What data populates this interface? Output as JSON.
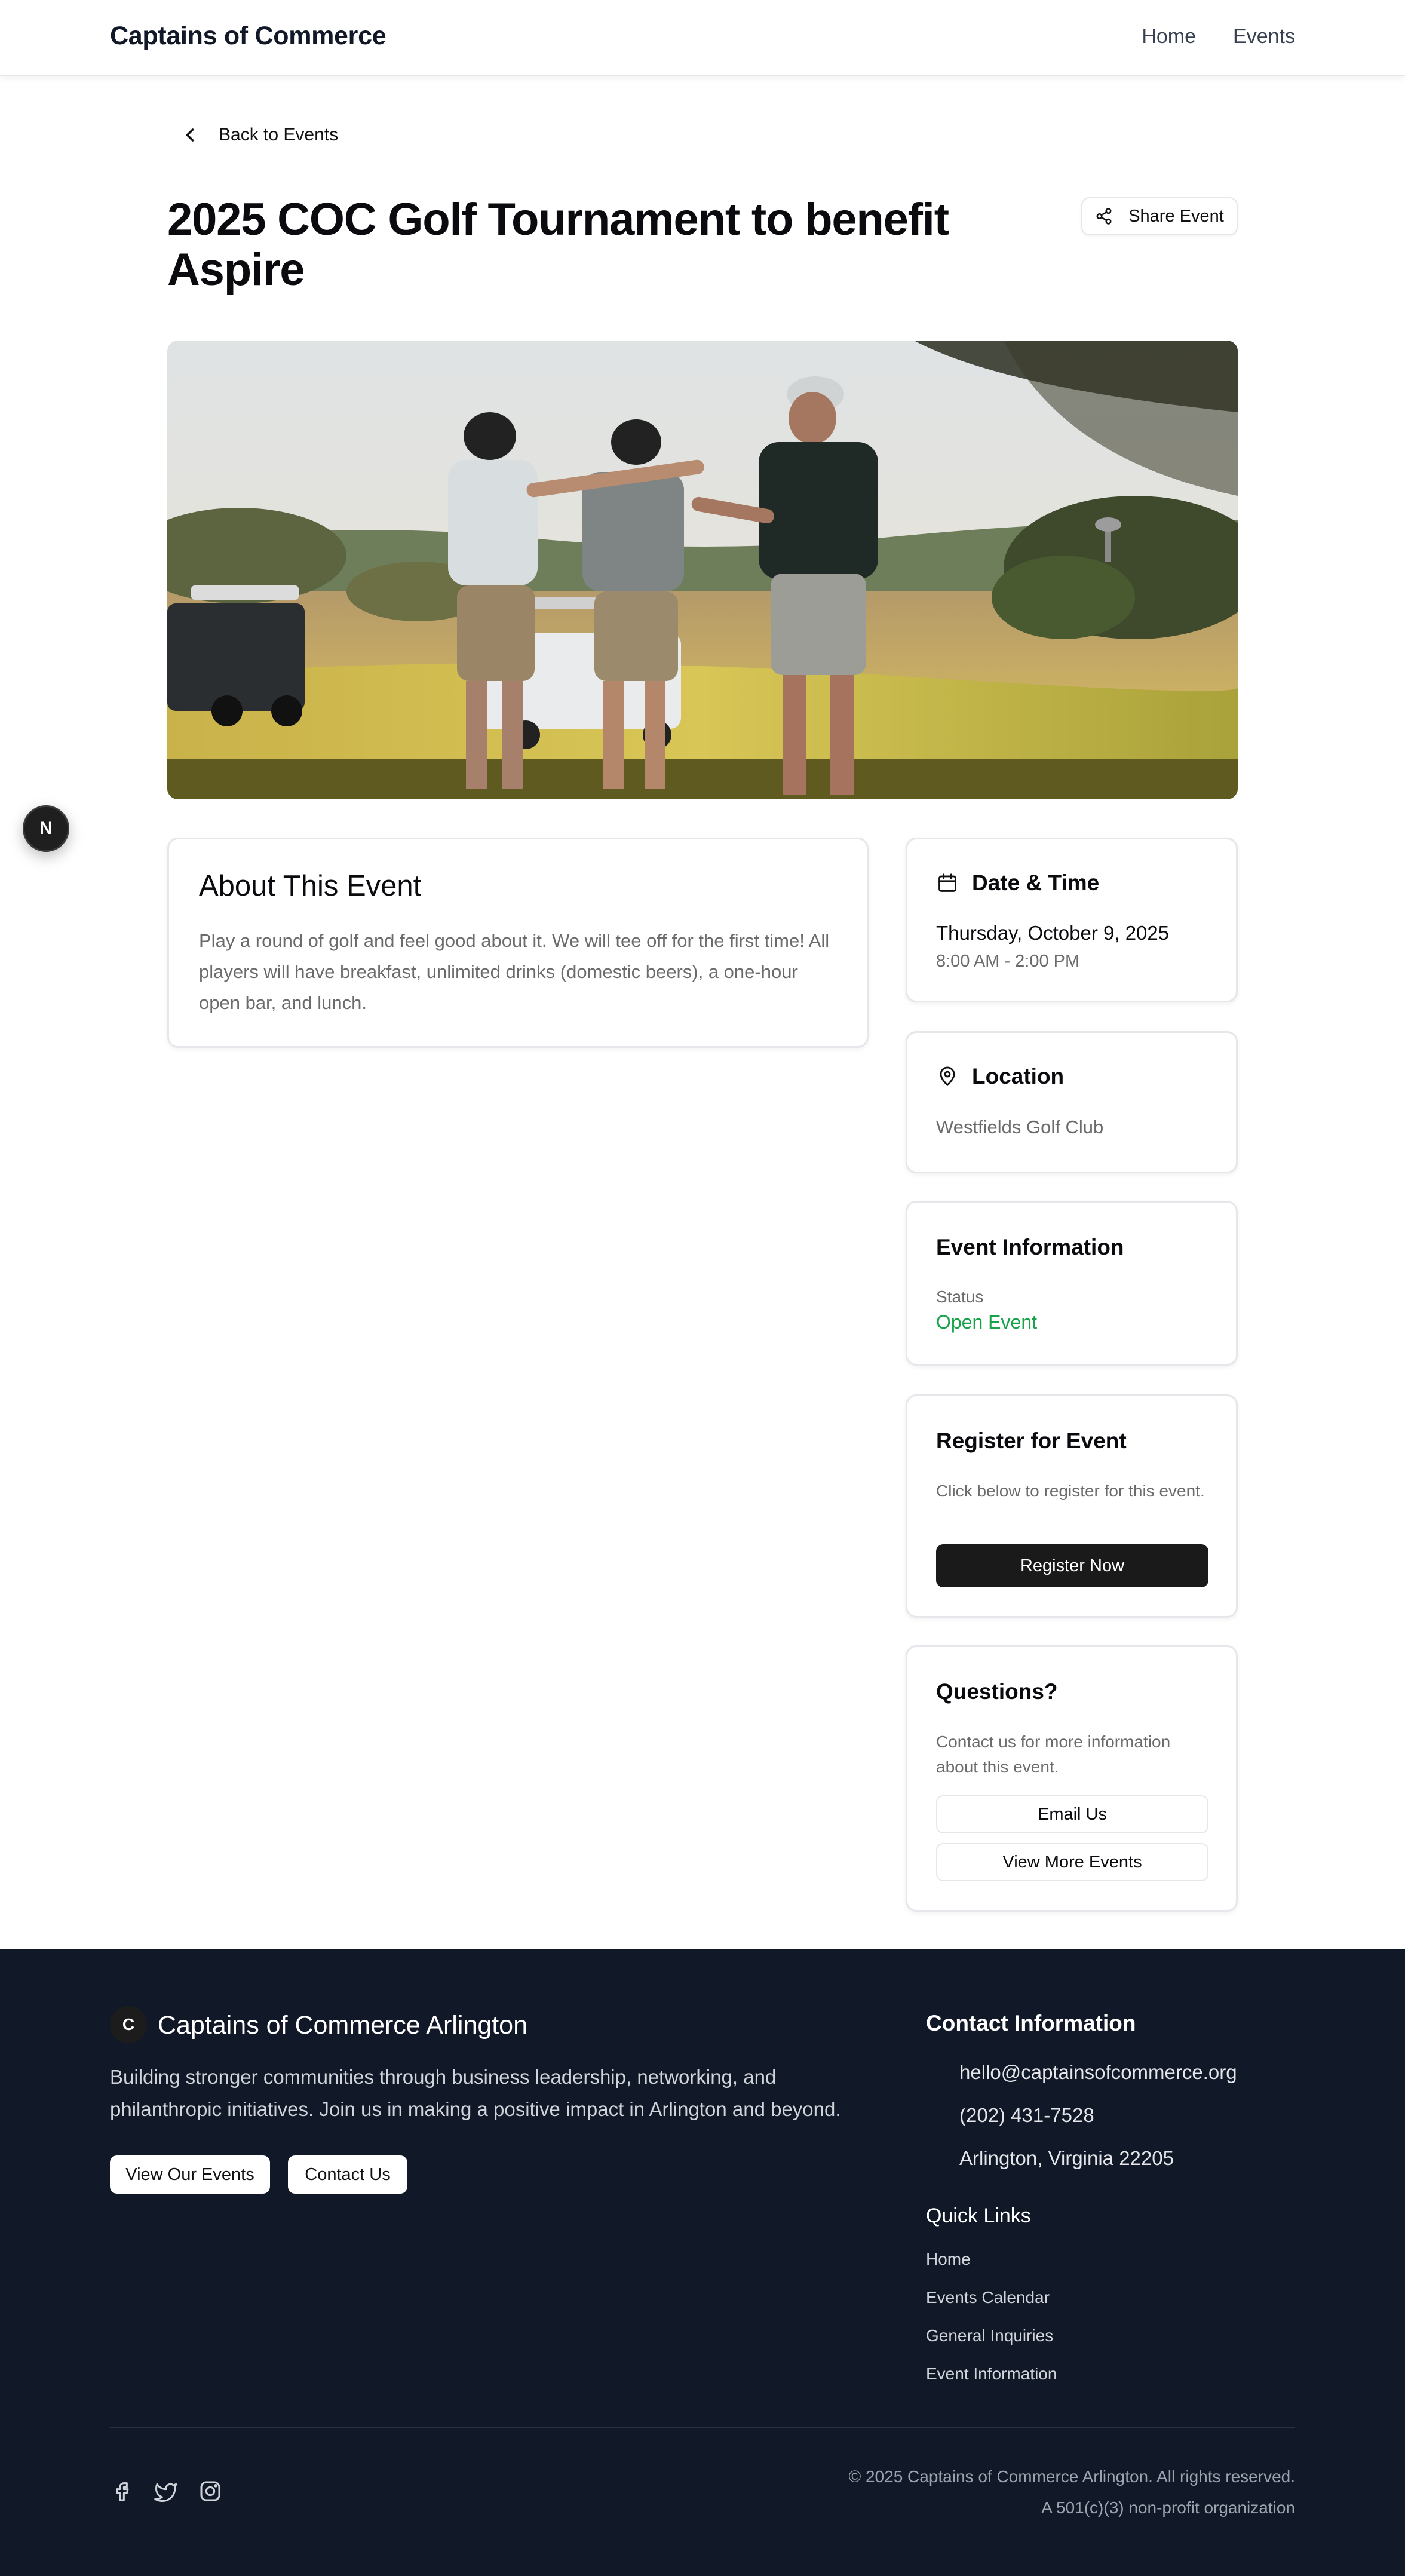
{
  "header": {
    "brand": "Captains of Commerce",
    "nav": [
      "Home",
      "Events"
    ]
  },
  "back_link": "Back to Events",
  "event": {
    "title": "2025 COC Golf Tournament to benefit Aspire",
    "share_label": "Share Event"
  },
  "dev_badge": "N",
  "about": {
    "heading": "About This Event",
    "body": "Play a round of golf and feel good about it. We will tee off for the first time! All players will have breakfast, unlimited drinks (domestic beers), a one-hour open bar, and lunch."
  },
  "date_time": {
    "heading": "Date & Time",
    "date": "Thursday, October 9, 2025",
    "time": "8:00 AM - 2:00 PM"
  },
  "location": {
    "heading": "Location",
    "value": "Westfields Golf Club"
  },
  "event_info": {
    "heading": "Event Information",
    "status_label": "Status",
    "status_value": "Open Event",
    "status_color": "#16a34a"
  },
  "register": {
    "heading": "Register for Event",
    "description": "Click below to register for this event.",
    "button": "Register Now"
  },
  "questions": {
    "heading": "Questions?",
    "description": "Contact us for more information about this event.",
    "email_button": "Email Us",
    "more_button": "View More Events"
  },
  "footer": {
    "logo_letter": "C",
    "brand": "Captains of Commerce Arlington",
    "description": "Building stronger communities through business leadership, networking, and philanthropic initiatives. Join us in making a positive impact in Arlington and beyond.",
    "buttons": [
      "View Our Events",
      "Contact Us"
    ],
    "contact_heading": "Contact Information",
    "email": "hello@captainsofcommerce.org",
    "phone": "(202) 431-7528",
    "address": "Arlington, Virginia 22205",
    "quick_links_heading": "Quick Links",
    "quick_links": [
      "Home",
      "Events Calendar",
      "General Inquiries",
      "Event Information"
    ],
    "social_icons": [
      "facebook-icon",
      "twitter-icon",
      "instagram-icon"
    ],
    "copyright": "© 2025 Captains of Commerce Arlington. All rights reserved.",
    "nonprofit": "A 501(c)(3) non-profit organization"
  },
  "colors": {
    "dark": "#1a1a1a",
    "footer_bg": "#111827",
    "status_green": "#16a34a"
  }
}
